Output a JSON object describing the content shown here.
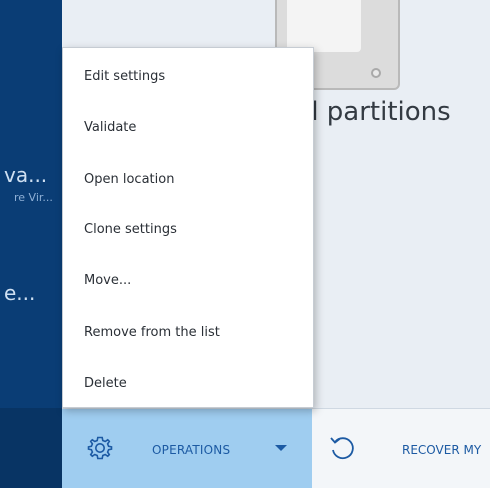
{
  "sidebar": {
    "fragments": [
      "va...",
      "re Vir...",
      "e..."
    ]
  },
  "main": {
    "title_fragment": "d partitions"
  },
  "menu": {
    "items": [
      {
        "label": "Edit settings"
      },
      {
        "label": "Validate"
      },
      {
        "label": "Open location"
      },
      {
        "label": "Clone settings"
      },
      {
        "label": "Move..."
      },
      {
        "label": "Remove from the list"
      },
      {
        "label": "Delete"
      }
    ]
  },
  "toolbar": {
    "operations_label": "OPERATIONS",
    "operations_icon": "gear-icon",
    "recover_label": "RECOVER MY",
    "recover_icon": "undo-icon"
  },
  "colors": {
    "sidebar": "#0a3d75",
    "accent": "#9fcdf0",
    "link": "#1c5aa3",
    "background": "#e9eef4"
  }
}
